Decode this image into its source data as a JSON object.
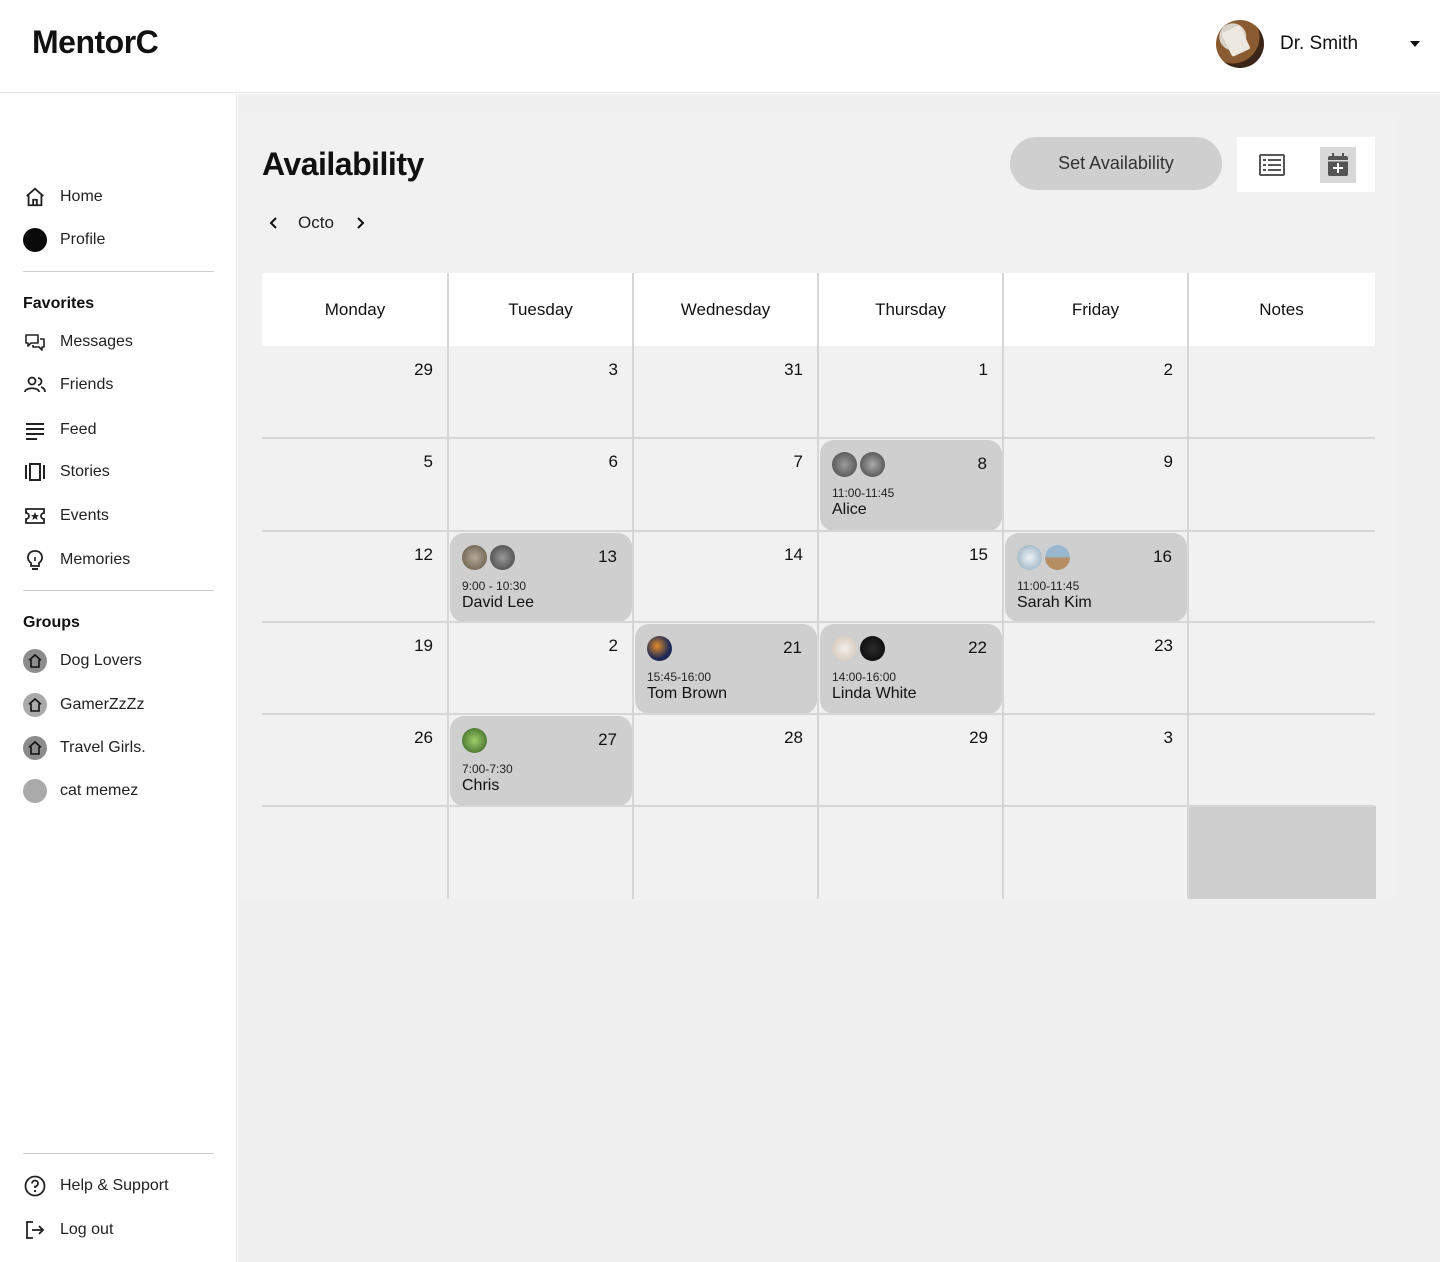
{
  "header": {
    "logo": "MentorC",
    "user_name": "Dr. Smith"
  },
  "sidebar": {
    "main_items": [
      {
        "label": "Home",
        "icon": "home-icon"
      },
      {
        "label": "Profile",
        "icon": "profile-avatar"
      }
    ],
    "favorites_title": "Favorites",
    "favorites": [
      {
        "label": "Messages",
        "icon": "messages-icon"
      },
      {
        "label": "Friends",
        "icon": "friends-icon"
      },
      {
        "label": "Feed",
        "icon": "feed-icon"
      },
      {
        "label": "Stories",
        "icon": "stories-icon"
      },
      {
        "label": "Events",
        "icon": "events-icon"
      },
      {
        "label": "Memories",
        "icon": "lightbulb-icon"
      }
    ],
    "groups_title": "Groups",
    "groups": [
      {
        "label": "Dog Lovers",
        "icon": "home-icon"
      },
      {
        "label": "GamerZzZz",
        "icon": "home-icon"
      },
      {
        "label": "Travel Girls.",
        "icon": "home-icon"
      },
      {
        "label": "cat memez",
        "icon": "group-avatar"
      }
    ],
    "footer": [
      {
        "label": "Help & Support",
        "icon": "help-icon"
      },
      {
        "label": "Log out",
        "icon": "logout-icon"
      }
    ]
  },
  "page": {
    "title": "Availability",
    "set_availability_label": "Set Availability",
    "month_label": "Octo",
    "view_list_icon": "list-view-icon",
    "view_calendar_icon": "calendar-add-icon"
  },
  "calendar": {
    "columns": [
      "Monday",
      "Tuesday",
      "Wednesday",
      "Thursday",
      "Friday",
      "Notes"
    ],
    "weeks": [
      [
        "29",
        "3",
        "31",
        "1",
        "2"
      ],
      [
        "5",
        "6",
        "7",
        "8",
        "9"
      ],
      [
        "12",
        "13",
        "14",
        "15",
        "16"
      ],
      [
        "19",
        "2",
        "21",
        "22",
        "23"
      ],
      [
        "26",
        "27",
        "28",
        "29",
        "3"
      ]
    ],
    "appointments": [
      {
        "week": 1,
        "day": 3,
        "time": "11:00-11:45",
        "name": "Alice"
      },
      {
        "week": 2,
        "day": 1,
        "time": "9:00 - 10:30",
        "name": "David Lee"
      },
      {
        "week": 2,
        "day": 4,
        "time": "11:00-11:45",
        "name": "Sarah Kim"
      },
      {
        "week": 3,
        "day": 2,
        "time": "15:45-16:00",
        "name": "Tom Brown"
      },
      {
        "week": 3,
        "day": 3,
        "time": "14:00-16:00",
        "name": "Linda White"
      },
      {
        "week": 4,
        "day": 1,
        "time": "7:00-7:30",
        "name": "Chris"
      }
    ]
  },
  "colors": {
    "appointment_bg": "#cfcfcf",
    "grid_bg": "#f0f0f0",
    "header_bg": "#ffffff"
  }
}
